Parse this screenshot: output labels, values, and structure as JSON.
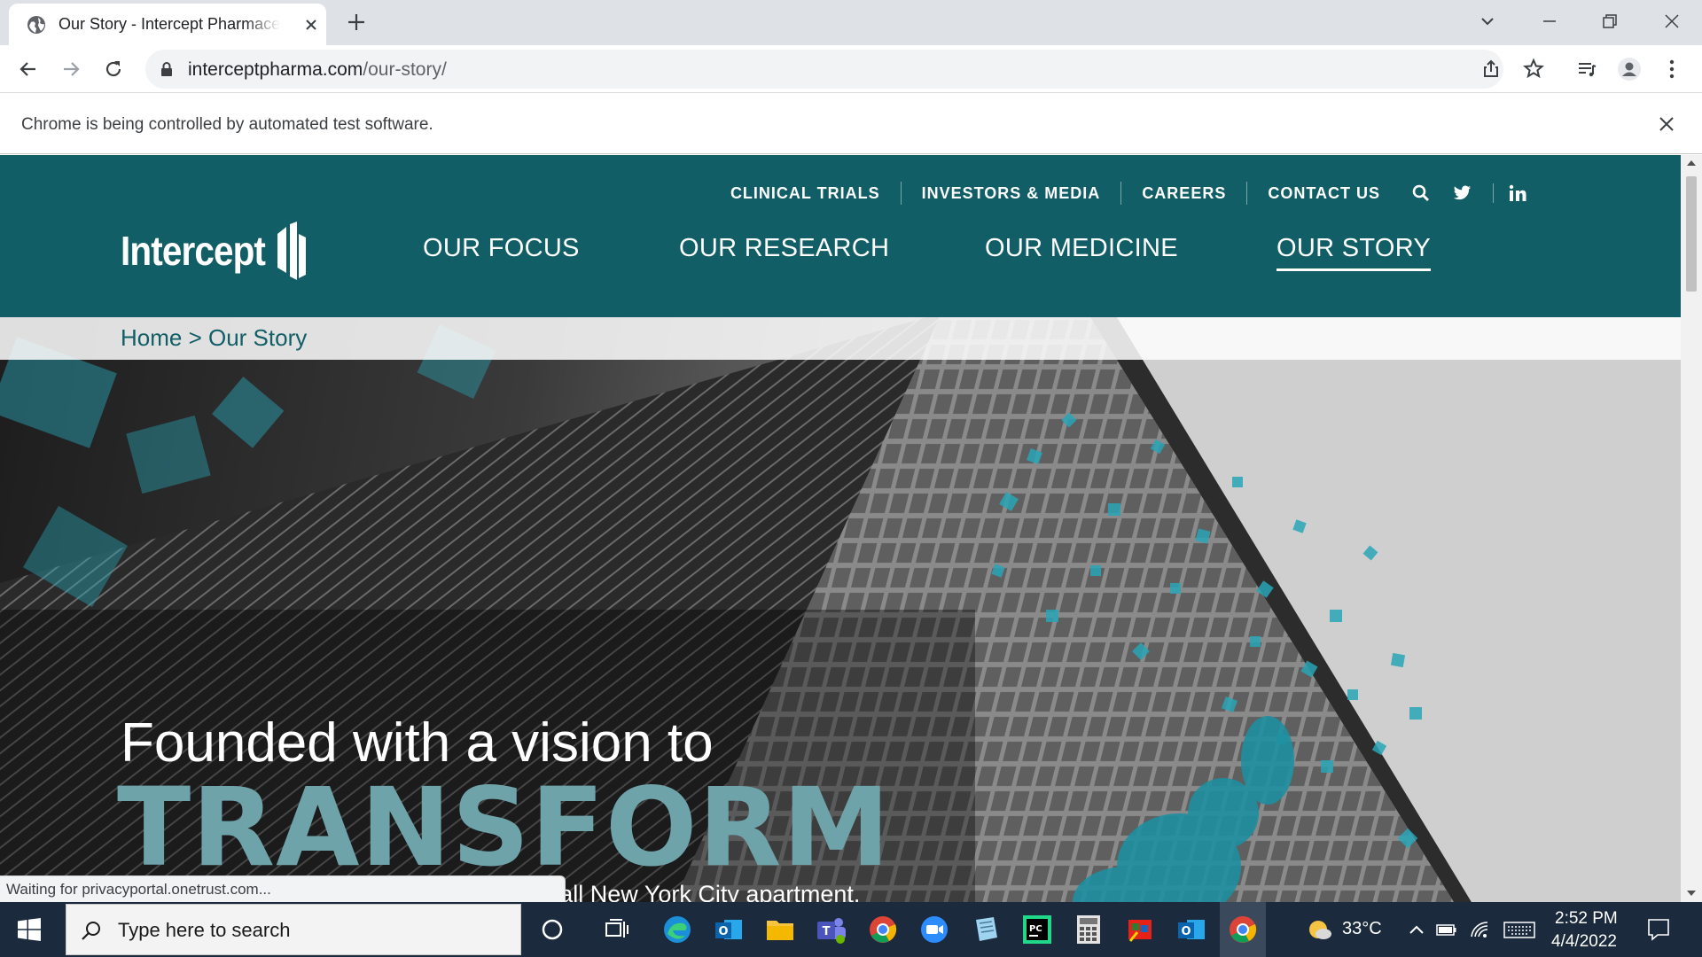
{
  "browser": {
    "tab_title": "Our Story - Intercept Pharmaceuticals",
    "url_host": "interceptpharma.com",
    "url_path": "/our-story/",
    "infobar_message": "Chrome is being controlled by automated test software.",
    "status_text": "Waiting for privacyportal.onetrust.com..."
  },
  "site": {
    "logo_text": "Intercept",
    "utility_nav": [
      "CLINICAL TRIALS",
      "INVESTORS & MEDIA",
      "CAREERS",
      "CONTACT US"
    ],
    "main_nav": [
      "OUR FOCUS",
      "OUR RESEARCH",
      "OUR MEDICINE",
      "OUR STORY"
    ],
    "active_nav": "OUR STORY",
    "breadcrumb": "Home > Our Story",
    "brand_color": "#115e67",
    "accent_color": "#6fa3aa"
  },
  "hero": {
    "heading_line1": "Founded with a vision to",
    "heading_line2": "TRANSFORM",
    "body": "We began as a vision in our founder’s small New York City apartment. Now we’re a biotech firm that’s nearly 500 people strong. Since 2002, we’ve pioneered a novel scientific platform to answer critical needs in the liver health community."
  },
  "taskbar": {
    "search_placeholder": "Type here to search",
    "weather": "33°C",
    "time": "2:52 PM",
    "date": "4/4/2022",
    "apps": [
      "cortana-icon",
      "task-view-icon",
      "edge-icon",
      "outlook-icon",
      "file-explorer-icon",
      "teams-icon",
      "chrome-icon",
      "zoom-icon",
      "notepad-icon",
      "pycharm-icon",
      "calculator-icon",
      "paint-icon",
      "outlook-icon",
      "chrome-icon"
    ]
  }
}
